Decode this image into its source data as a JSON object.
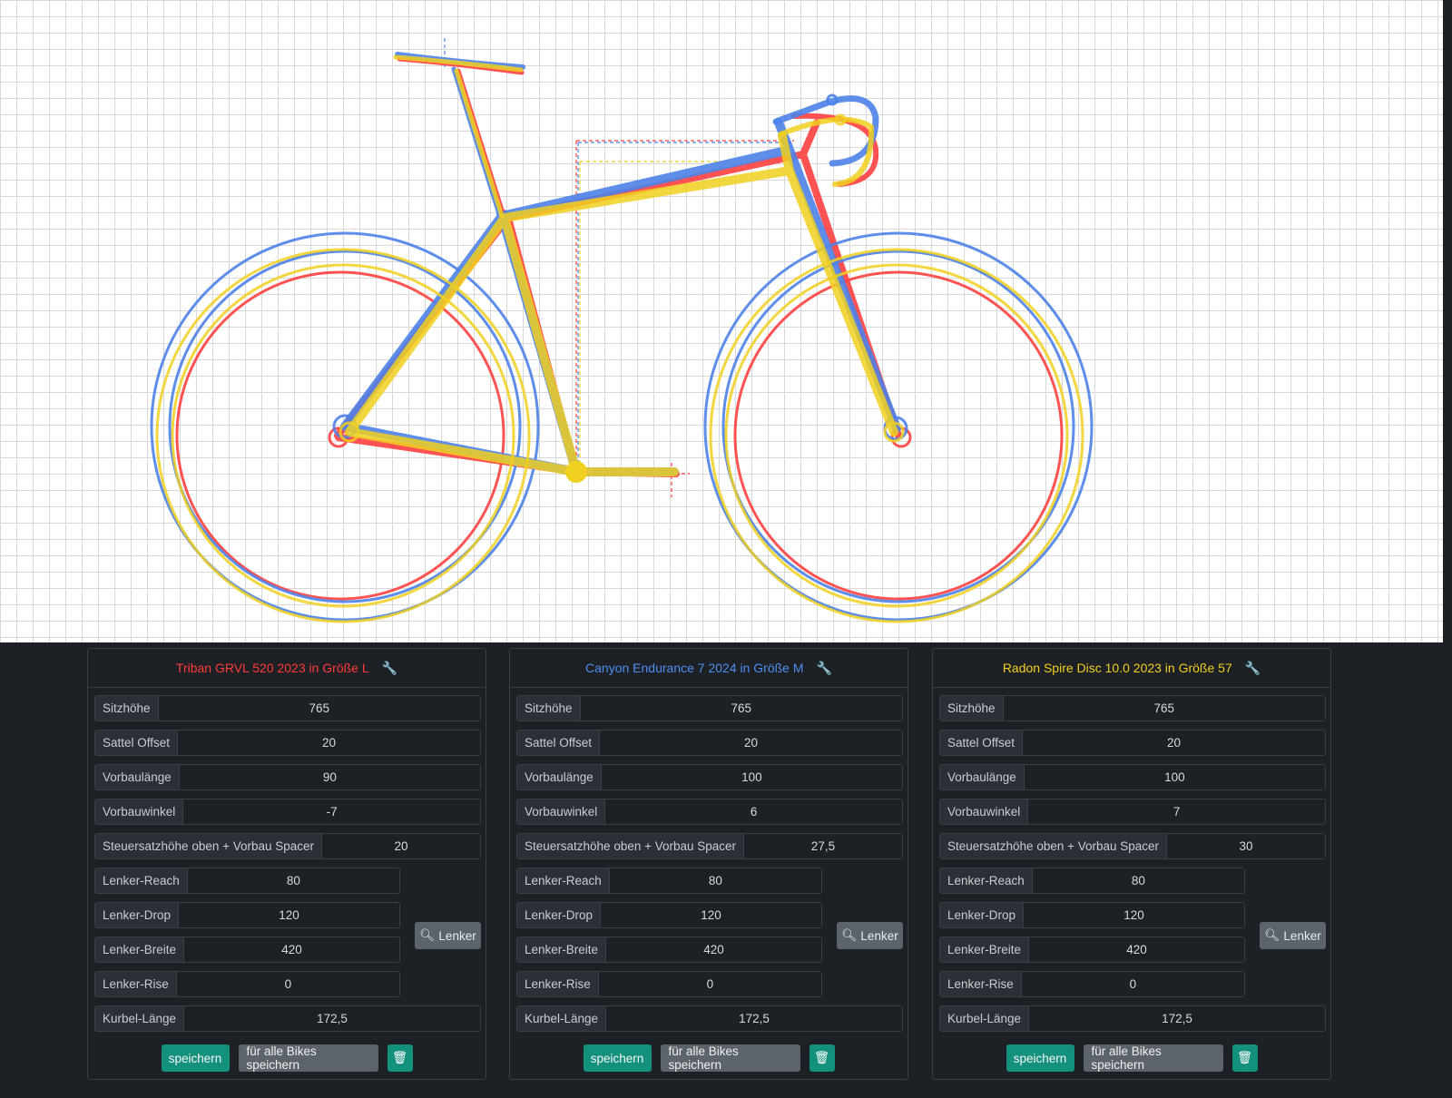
{
  "colors": {
    "red": "#ff4040",
    "blue": "#4d82e8",
    "yellow": "#f0d020"
  },
  "panels": [
    {
      "title": "Triban GRVL 520 2023 in Größe L",
      "title_color": "#ff3b3b",
      "fields": {
        "sitzhoehe": {
          "label": "Sitzhöhe",
          "value": "765"
        },
        "sattel_offset": {
          "label": "Sattel Offset",
          "value": "20"
        },
        "vorbaulaenge": {
          "label": "Vorbaulänge",
          "value": "90"
        },
        "vorbauwinkel": {
          "label": "Vorbauwinkel",
          "value": "-7"
        },
        "steuersatz": {
          "label": "Steuersatzhöhe oben + Vorbau Spacer",
          "value": "20"
        },
        "lenker_reach": {
          "label": "Lenker-Reach",
          "value": "80"
        },
        "lenker_drop": {
          "label": "Lenker-Drop",
          "value": "120"
        },
        "lenker_breite": {
          "label": "Lenker-Breite",
          "value": "420"
        },
        "lenker_rise": {
          "label": "Lenker-Rise",
          "value": "0"
        },
        "kurbel_laenge": {
          "label": "Kurbel-Länge",
          "value": "172,5"
        }
      },
      "lenker_button": "Lenker",
      "save": "speichern",
      "save_all": "für alle Bikes speichern",
      "delete_icon": "trash-icon"
    },
    {
      "title": "Canyon Endurance 7 2024 in Größe M",
      "title_color": "#4d8ff0",
      "fields": {
        "sitzhoehe": {
          "label": "Sitzhöhe",
          "value": "765"
        },
        "sattel_offset": {
          "label": "Sattel Offset",
          "value": "20"
        },
        "vorbaulaenge": {
          "label": "Vorbaulänge",
          "value": "100"
        },
        "vorbauwinkel": {
          "label": "Vorbauwinkel",
          "value": "6"
        },
        "steuersatz": {
          "label": "Steuersatzhöhe oben + Vorbau Spacer",
          "value": "27,5"
        },
        "lenker_reach": {
          "label": "Lenker-Reach",
          "value": "80"
        },
        "lenker_drop": {
          "label": "Lenker-Drop",
          "value": "120"
        },
        "lenker_breite": {
          "label": "Lenker-Breite",
          "value": "420"
        },
        "lenker_rise": {
          "label": "Lenker-Rise",
          "value": "0"
        },
        "kurbel_laenge": {
          "label": "Kurbel-Länge",
          "value": "172,5"
        }
      },
      "lenker_button": "Lenker",
      "save": "speichern",
      "save_all": "für alle Bikes speichern",
      "delete_icon": "trash-icon"
    },
    {
      "title": "Radon Spire Disc 10.0 2023 in Größe 57",
      "title_color": "#f0d020",
      "fields": {
        "sitzhoehe": {
          "label": "Sitzhöhe",
          "value": "765"
        },
        "sattel_offset": {
          "label": "Sattel Offset",
          "value": "20"
        },
        "vorbaulaenge": {
          "label": "Vorbaulänge",
          "value": "100"
        },
        "vorbauwinkel": {
          "label": "Vorbauwinkel",
          "value": "7"
        },
        "steuersatz": {
          "label": "Steuersatzhöhe oben + Vorbau Spacer",
          "value": "30"
        },
        "lenker_reach": {
          "label": "Lenker-Reach",
          "value": "80"
        },
        "lenker_drop": {
          "label": "Lenker-Drop",
          "value": "120"
        },
        "lenker_breite": {
          "label": "Lenker-Breite",
          "value": "420"
        },
        "lenker_rise": {
          "label": "Lenker-Rise",
          "value": "0"
        },
        "kurbel_laenge": {
          "label": "Kurbel-Länge",
          "value": "172,5"
        }
      },
      "lenker_button": "Lenker",
      "save": "speichern",
      "save_all": "für alle Bikes speichern",
      "delete_icon": "trash-icon"
    }
  ]
}
